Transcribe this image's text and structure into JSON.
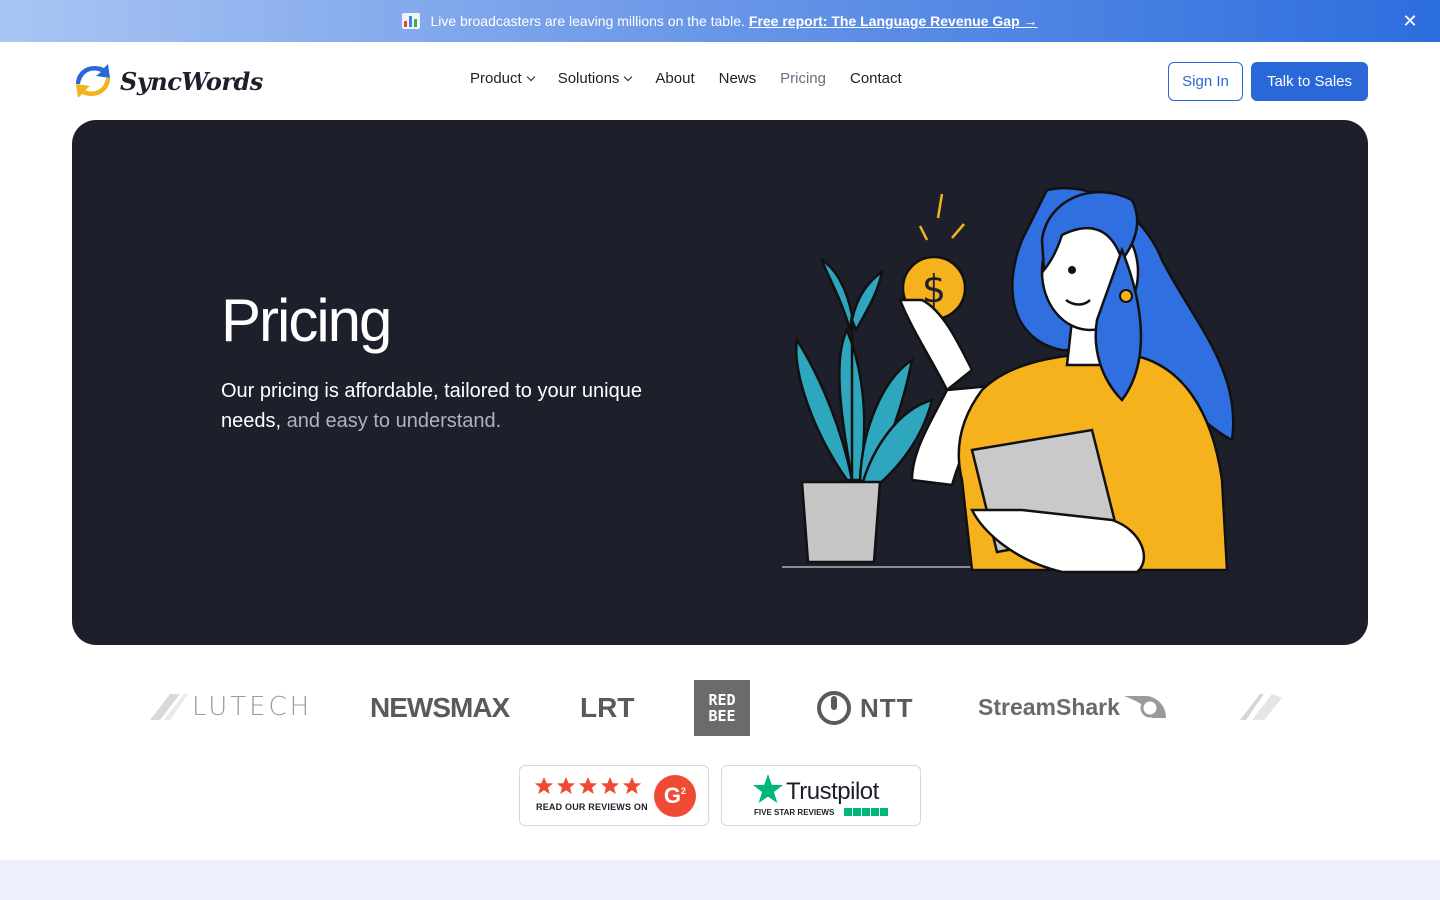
{
  "announcement": {
    "text": "Live broadcasters are leaving millions on the table.",
    "link": "Free report: The Language Revenue Gap →",
    "close": "✕"
  },
  "header": {
    "logo_text": "SyncWords",
    "nav": [
      {
        "label": "Product",
        "has_dropdown": true
      },
      {
        "label": "Solutions",
        "has_dropdown": true
      },
      {
        "label": "About"
      },
      {
        "label": "News"
      },
      {
        "label": "Pricing",
        "active": true
      },
      {
        "label": "Contact"
      }
    ],
    "signin": "Sign In",
    "sales": "Talk to Sales"
  },
  "hero": {
    "title": "Pricing",
    "subtitle_main": "Our pricing is affordable, tailored to your unique needs,",
    "subtitle_muted": "and easy to understand.",
    "coin_symbol": "$"
  },
  "logos": {
    "lutech": "LUTECH",
    "newsmax": "NEWSMAX",
    "lrt": "LRT",
    "redbee_top": "RED",
    "redbee_bottom": "BEE",
    "ntt": "NTT",
    "streamshark": "StreamShark"
  },
  "reviews": {
    "g2_text": "READ OUR REVIEWS ON",
    "g2_badge": "G",
    "trustpilot_name": "Trustpilot",
    "trustpilot_sub": "FIVE STAR REVIEWS"
  },
  "colors": {
    "accent": "#2a67d8",
    "hero_bg": "#1d1f2b",
    "coin": "#f6b21c",
    "hair": "#2f6fe0",
    "plant": "#2ea7be",
    "g2_red": "#ef4a33",
    "trust_green": "#00b67a"
  }
}
